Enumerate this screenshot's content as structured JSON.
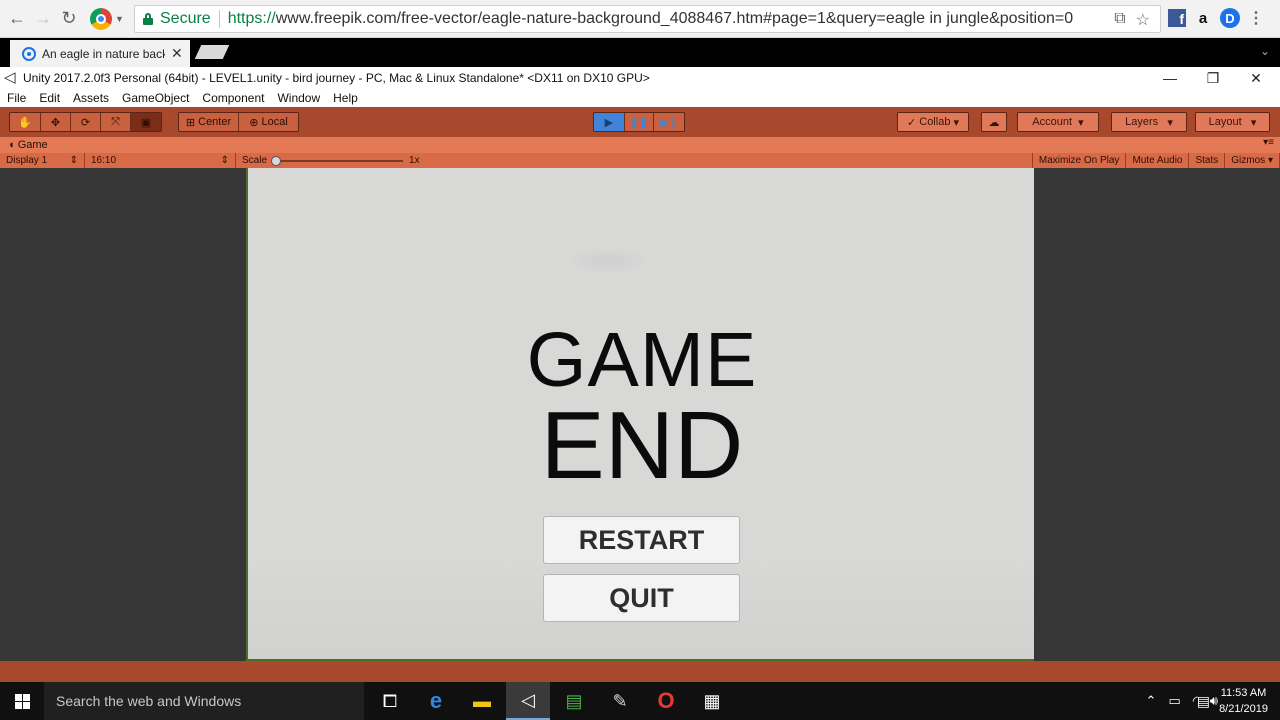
{
  "browser": {
    "secure_label": "Secure",
    "url_proto": "https://",
    "url_rest": "www.freepik.com/free-vector/eagle-nature-background_4088467.htm#page=1&query=eagle in jungle&position=0",
    "tab_title": "An eagle in nature backg",
    "ext_facebook": "f",
    "ext_amazon": "a",
    "ext_d": "D"
  },
  "unity": {
    "window_title": "Unity 2017.2.0f3 Personal (64bit) - LEVEL1.unity - bird journey - PC, Mac & Linux Standalone* <DX11 on DX10 GPU>",
    "menu": [
      "File",
      "Edit",
      "Assets",
      "GameObject",
      "Component",
      "Window",
      "Help"
    ],
    "toolbar": {
      "pivot_center": "Center",
      "pivot_local": "Local",
      "collab": "Collab",
      "account": "Account",
      "layers": "Layers",
      "layout": "Layout"
    },
    "game_tab": {
      "label": "Game",
      "display": "Display 1",
      "aspect": "16:10",
      "scale_label": "Scale",
      "scale_value": "1x",
      "maximize": "Maximize On Play",
      "mute": "Mute Audio",
      "stats": "Stats",
      "gizmos": "Gizmos"
    },
    "play_state": "playing"
  },
  "game": {
    "title_line1": "GAME",
    "title_line2": "END",
    "restart_label": "RESTART",
    "quit_label": "QUIT"
  },
  "taskbar": {
    "search_placeholder": "Search the web and Windows",
    "time": "11:53 AM",
    "date": "8/21/2019"
  },
  "colors": {
    "unity_toolbar": "#a8482d",
    "game_tab": "#e37a55",
    "game_background": "#d8d8d7"
  }
}
